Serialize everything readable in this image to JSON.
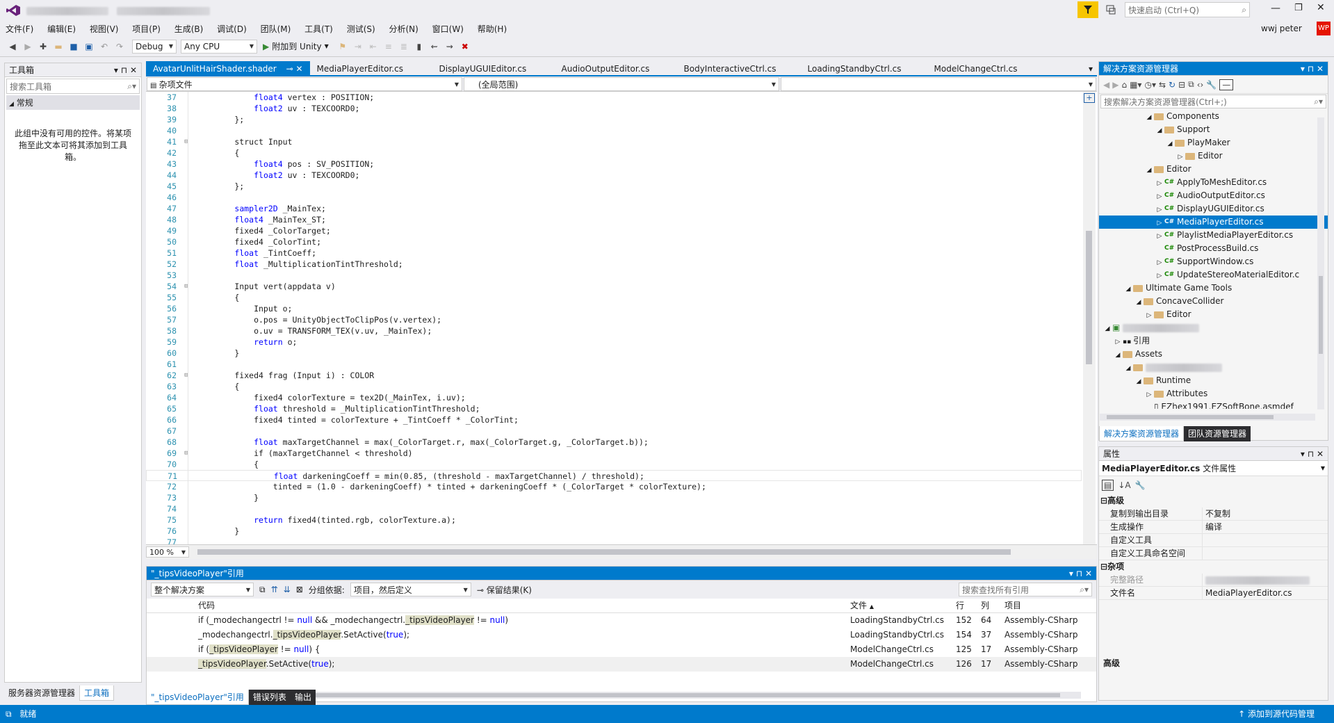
{
  "title_bar": {
    "quick_launch_placeholder": "快速启动 (Ctrl+Q)",
    "user_name": "wwj peter",
    "user_initials": "WP"
  },
  "menu": [
    "文件(F)",
    "编辑(E)",
    "视图(V)",
    "项目(P)",
    "生成(B)",
    "调试(D)",
    "团队(M)",
    "工具(T)",
    "测试(S)",
    "分析(N)",
    "窗口(W)",
    "帮助(H)"
  ],
  "toolbar": {
    "config": "Debug",
    "platform": "Any CPU",
    "attach_label": "附加到 Unity"
  },
  "toolbox": {
    "title": "工具箱",
    "search_placeholder": "搜索工具箱",
    "section": "常规",
    "empty_message": "此组中没有可用的控件。将某项拖至此文本可将其添加到工具箱。",
    "bottom_tabs": [
      "服务器资源管理器",
      "工具箱"
    ]
  },
  "editor": {
    "tabs": [
      "AvatarUnlitHairShader.shader",
      "MediaPlayerEditor.cs",
      "DisplayUGUIEditor.cs",
      "AudioOutputEditor.cs",
      "BodyInteractiveCtrl.cs",
      "LoadingStandbyCtrl.cs",
      "ModelChangeCtrl.cs"
    ],
    "nav_left": "杂项文件",
    "nav_mid": "(全局范围)",
    "zoom": "100 %",
    "lines": [
      {
        "n": "37",
        "t": "            float4 vertex : POSITION;"
      },
      {
        "n": "38",
        "t": "            float2 uv : TEXCOORD0;"
      },
      {
        "n": "39",
        "t": "        };"
      },
      {
        "n": "40",
        "t": ""
      },
      {
        "n": "41",
        "t": "        struct Input"
      },
      {
        "n": "42",
        "t": "        {"
      },
      {
        "n": "43",
        "t": "            float4 pos : SV_POSITION;"
      },
      {
        "n": "44",
        "t": "            float2 uv : TEXCOORD0;"
      },
      {
        "n": "45",
        "t": "        };"
      },
      {
        "n": "46",
        "t": ""
      },
      {
        "n": "47",
        "t": "        sampler2D _MainTex;"
      },
      {
        "n": "48",
        "t": "        float4 _MainTex_ST;"
      },
      {
        "n": "49",
        "t": "        fixed4 _ColorTarget;"
      },
      {
        "n": "50",
        "t": "        fixed4 _ColorTint;"
      },
      {
        "n": "51",
        "t": "        float _TintCoeff;"
      },
      {
        "n": "52",
        "t": "        float _MultiplicationTintThreshold;"
      },
      {
        "n": "53",
        "t": ""
      },
      {
        "n": "54",
        "t": "        Input vert(appdata v)"
      },
      {
        "n": "55",
        "t": "        {"
      },
      {
        "n": "56",
        "t": "            Input o;"
      },
      {
        "n": "57",
        "t": "            o.pos = UnityObjectToClipPos(v.vertex);"
      },
      {
        "n": "58",
        "t": "            o.uv = TRANSFORM_TEX(v.uv, _MainTex);"
      },
      {
        "n": "59",
        "t": "            return o;"
      },
      {
        "n": "60",
        "t": "        }"
      },
      {
        "n": "61",
        "t": ""
      },
      {
        "n": "62",
        "t": "        fixed4 frag (Input i) : COLOR"
      },
      {
        "n": "63",
        "t": "        {"
      },
      {
        "n": "64",
        "t": "            fixed4 colorTexture = tex2D(_MainTex, i.uv);"
      },
      {
        "n": "65",
        "t": "            float threshold = _MultiplicationTintThreshold;"
      },
      {
        "n": "66",
        "t": "            fixed4 tinted = colorTexture + _TintCoeff * _ColorTint;"
      },
      {
        "n": "67",
        "t": ""
      },
      {
        "n": "68",
        "t": "            float maxTargetChannel = max(_ColorTarget.r, max(_ColorTarget.g, _ColorTarget.b));"
      },
      {
        "n": "69",
        "t": "            if (maxTargetChannel < threshold)"
      },
      {
        "n": "70",
        "t": "            {"
      },
      {
        "n": "71",
        "t": "                float darkeningCoeff = min(0.85, (threshold - maxTargetChannel) / threshold);"
      },
      {
        "n": "72",
        "t": "                tinted = (1.0 - darkeningCoeff) * tinted + darkeningCoeff * (_ColorTarget * colorTexture);"
      },
      {
        "n": "73",
        "t": "            }"
      },
      {
        "n": "74",
        "t": ""
      },
      {
        "n": "75",
        "t": "            return fixed4(tinted.rgb, colorTexture.a);"
      },
      {
        "n": "76",
        "t": "        }"
      },
      {
        "n": "77",
        "t": ""
      }
    ]
  },
  "solution": {
    "title": "解决方案资源管理器",
    "search_placeholder": "搜索解决方案资源管理器(Ctrl+;)",
    "items": [
      {
        "label": "Components",
        "type": "folder",
        "indent": 5,
        "exp": "◢"
      },
      {
        "label": "Support",
        "type": "folder",
        "indent": 6,
        "exp": "◢"
      },
      {
        "label": "PlayMaker",
        "type": "folder",
        "indent": 7,
        "exp": "◢"
      },
      {
        "label": "Editor",
        "type": "folder",
        "indent": 8,
        "exp": "▷"
      },
      {
        "label": "Editor",
        "type": "folder",
        "indent": 5,
        "exp": "◢"
      },
      {
        "label": "ApplyToMeshEditor.cs",
        "type": "cs",
        "indent": 6,
        "exp": "▷"
      },
      {
        "label": "AudioOutputEditor.cs",
        "type": "cs",
        "indent": 6,
        "exp": "▷"
      },
      {
        "label": "DisplayUGUIEditor.cs",
        "type": "cs",
        "indent": 6,
        "exp": "▷"
      },
      {
        "label": "MediaPlayerEditor.cs",
        "type": "cs",
        "indent": 6,
        "exp": "▷",
        "sel": true
      },
      {
        "label": "PlaylistMediaPlayerEditor.cs",
        "type": "cs",
        "indent": 6,
        "exp": "▷"
      },
      {
        "label": "PostProcessBuild.cs",
        "type": "cs",
        "indent": 6,
        "exp": ""
      },
      {
        "label": "SupportWindow.cs",
        "type": "cs",
        "indent": 6,
        "exp": "▷"
      },
      {
        "label": "UpdateStereoMaterialEditor.c",
        "type": "cs",
        "indent": 6,
        "exp": "▷"
      },
      {
        "label": "Ultimate Game Tools",
        "type": "folder",
        "indent": 3,
        "exp": "◢"
      },
      {
        "label": "ConcaveCollider",
        "type": "folder",
        "indent": 4,
        "exp": "◢"
      },
      {
        "label": "Editor",
        "type": "folder",
        "indent": 5,
        "exp": "▷"
      },
      {
        "label": "",
        "type": "blur",
        "indent": 1,
        "exp": "◢"
      },
      {
        "label": "引用",
        "type": "ref",
        "indent": 2,
        "exp": "▷"
      },
      {
        "label": "Assets",
        "type": "folder",
        "indent": 2,
        "exp": "◢"
      },
      {
        "label": "",
        "type": "blurfolder",
        "indent": 3,
        "exp": "◢"
      },
      {
        "label": "Runtime",
        "type": "folder",
        "indent": 4,
        "exp": "◢"
      },
      {
        "label": "Attributes",
        "type": "folder",
        "indent": 5,
        "exp": "▷"
      },
      {
        "label": "EZhex1991.EZSoftBone.asmdef",
        "type": "file",
        "indent": 5,
        "exp": ""
      }
    ],
    "bottom_tabs": [
      "解决方案资源管理器",
      "团队资源管理器"
    ]
  },
  "properties": {
    "title": "属性",
    "object": "MediaPlayerEditor.cs",
    "object_type": "文件属性",
    "sections": [
      {
        "name": "高级",
        "rows": [
          [
            "复制到输出目录",
            "不复制"
          ],
          [
            "生成操作",
            "编译"
          ],
          [
            "自定义工具",
            ""
          ],
          [
            "自定义工具命名空间",
            ""
          ]
        ]
      },
      {
        "name": "杂项",
        "rows": [
          [
            "完整路径",
            ""
          ],
          [
            "文件名",
            "MediaPlayerEditor.cs"
          ]
        ]
      }
    ],
    "description": "高级"
  },
  "references": {
    "title": "\"_tipsVideoPlayer\"引用",
    "scope": "整个解决方案",
    "group_label": "分组依据:",
    "group_value": "项目，然后定义",
    "keep_label": "保留结果(K)",
    "search_placeholder": "搜索查找所有引用",
    "headers": [
      "代码",
      "文件",
      "行",
      "列",
      "项目"
    ],
    "rows": [
      {
        "code": "if (_modechangectrl != null && _modechangectrl._tipsVideoPlayer != null)",
        "file": "LoadingStandbyCtrl.cs",
        "line": "152",
        "col": "64",
        "project": "Assembly-CSharp"
      },
      {
        "code": "_modechangectrl._tipsVideoPlayer.SetActive(true);",
        "file": "LoadingStandbyCtrl.cs",
        "line": "154",
        "col": "37",
        "project": "Assembly-CSharp"
      },
      {
        "code": "if (_tipsVideoPlayer != null) {",
        "file": "ModelChangeCtrl.cs",
        "line": "125",
        "col": "17",
        "project": "Assembly-CSharp"
      },
      {
        "code": "_tipsVideoPlayer.SetActive(true);",
        "file": "ModelChangeCtrl.cs",
        "line": "126",
        "col": "17",
        "project": "Assembly-CSharp"
      }
    ],
    "bottom_tabs": [
      "\"_tipsVideoPlayer\"引用",
      "错误列表",
      "输出"
    ]
  },
  "status": {
    "left": "就绪",
    "right": "添加到源代码管理"
  }
}
